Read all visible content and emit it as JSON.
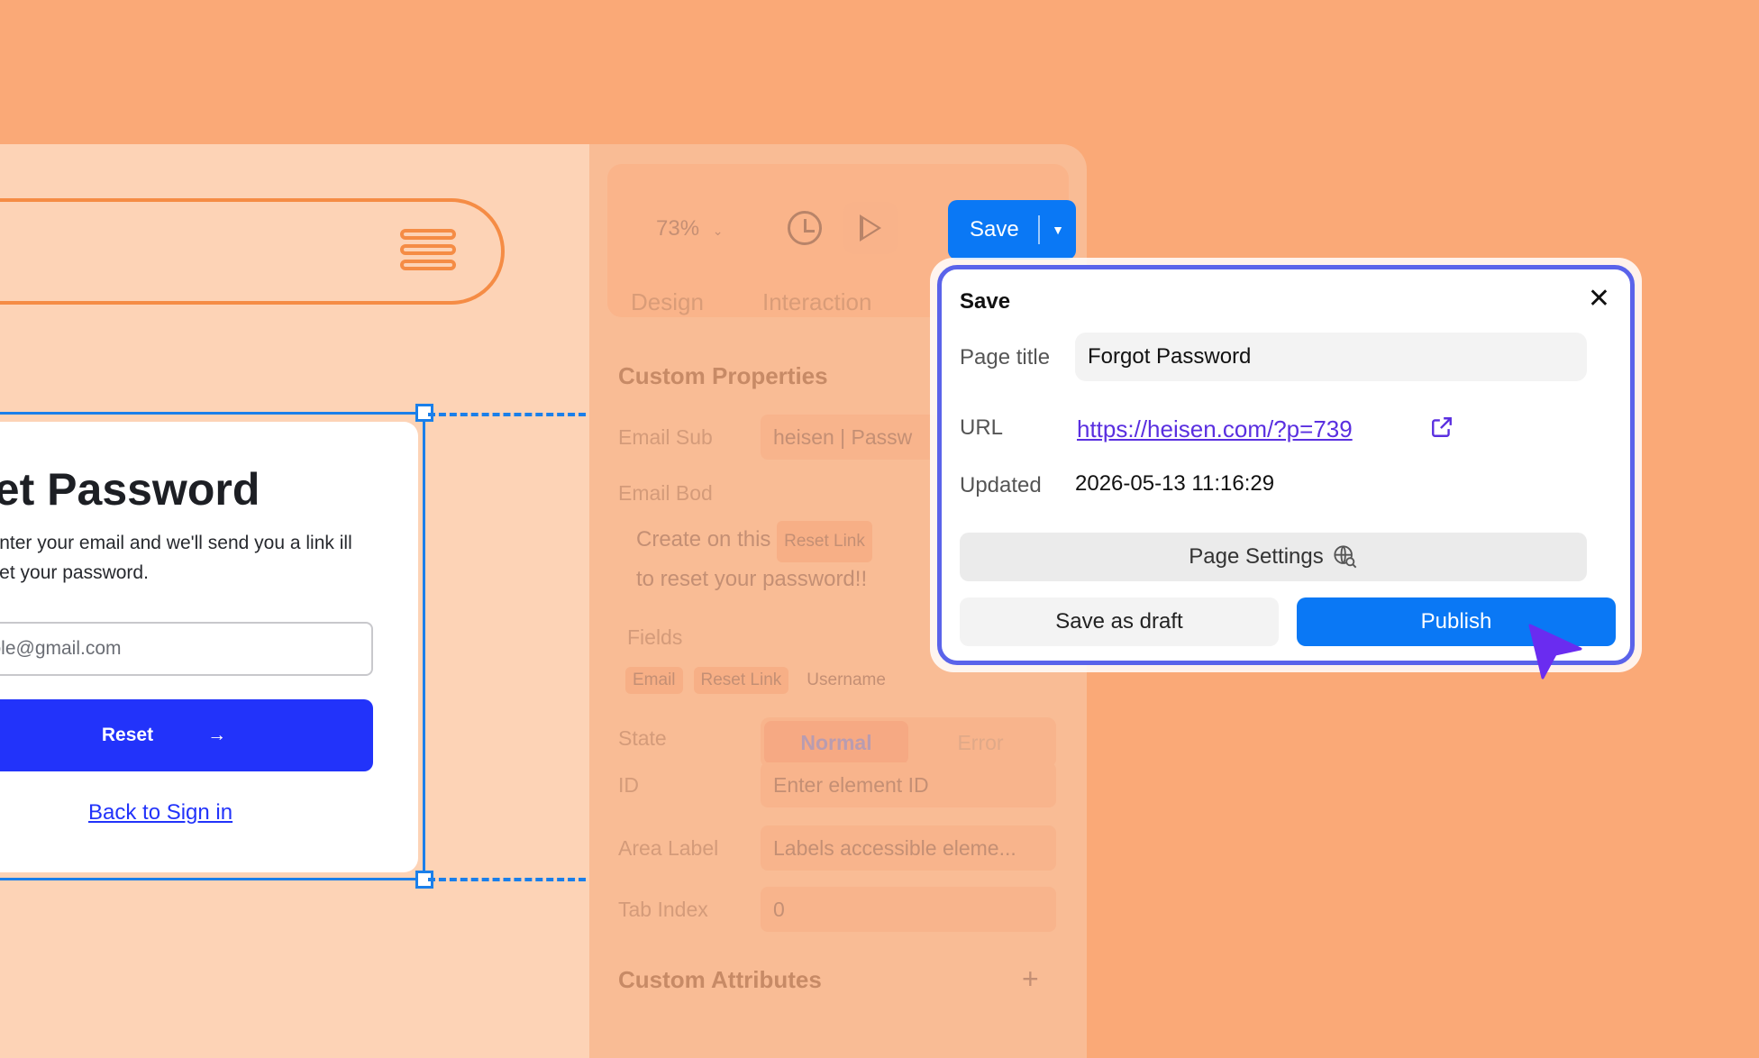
{
  "canvas": {
    "card_title": "set Password",
    "card_subtitle": "e enter your email and we'll send you a link ill reset your password.",
    "email_placeholder": "mple@gmail.com",
    "reset_label": "Reset",
    "back_link": "Back to Sign in"
  },
  "toolbar": {
    "zoom": "73%",
    "save_label": "Save",
    "tabs": [
      "Design",
      "Interaction"
    ]
  },
  "properties": {
    "custom_properties_title": "Custom Properties",
    "email_sub_label": "Email Sub",
    "email_sub_value": "heisen | Passw",
    "email_body_label": "Email Bod",
    "email_body_line1": "Create on this",
    "email_body_chip": "Reset Link",
    "email_body_line2": "to reset your password!!",
    "fields_label": "Fields",
    "fields": [
      "Email",
      "Reset Link",
      "Username"
    ],
    "state_label": "State",
    "state_options": [
      "Normal",
      "Error"
    ],
    "id_label": "ID",
    "id_placeholder": "Enter element ID",
    "area_label": "Area Label",
    "area_placeholder": "Labels accessible eleme...",
    "tab_index_label": "Tab Index",
    "tab_index_value": "0",
    "custom_attributes_title": "Custom Attributes"
  },
  "modal": {
    "title": "Save",
    "page_title_label": "Page title",
    "page_title_value": "Forgot Password",
    "url_label": "URL",
    "url_value": "https://heisen.com/?p=739",
    "updated_label": "Updated",
    "updated_value": "2026-05-13 11:16:29",
    "page_settings_label": "Page Settings",
    "save_draft_label": "Save as draft",
    "publish_label": "Publish"
  },
  "colors": {
    "background": "#FAA977",
    "accent_blue": "#0A78F5",
    "reset_button": "#2233FA",
    "modal_border": "#5A63EA",
    "cursor": "#6A2CF0"
  }
}
